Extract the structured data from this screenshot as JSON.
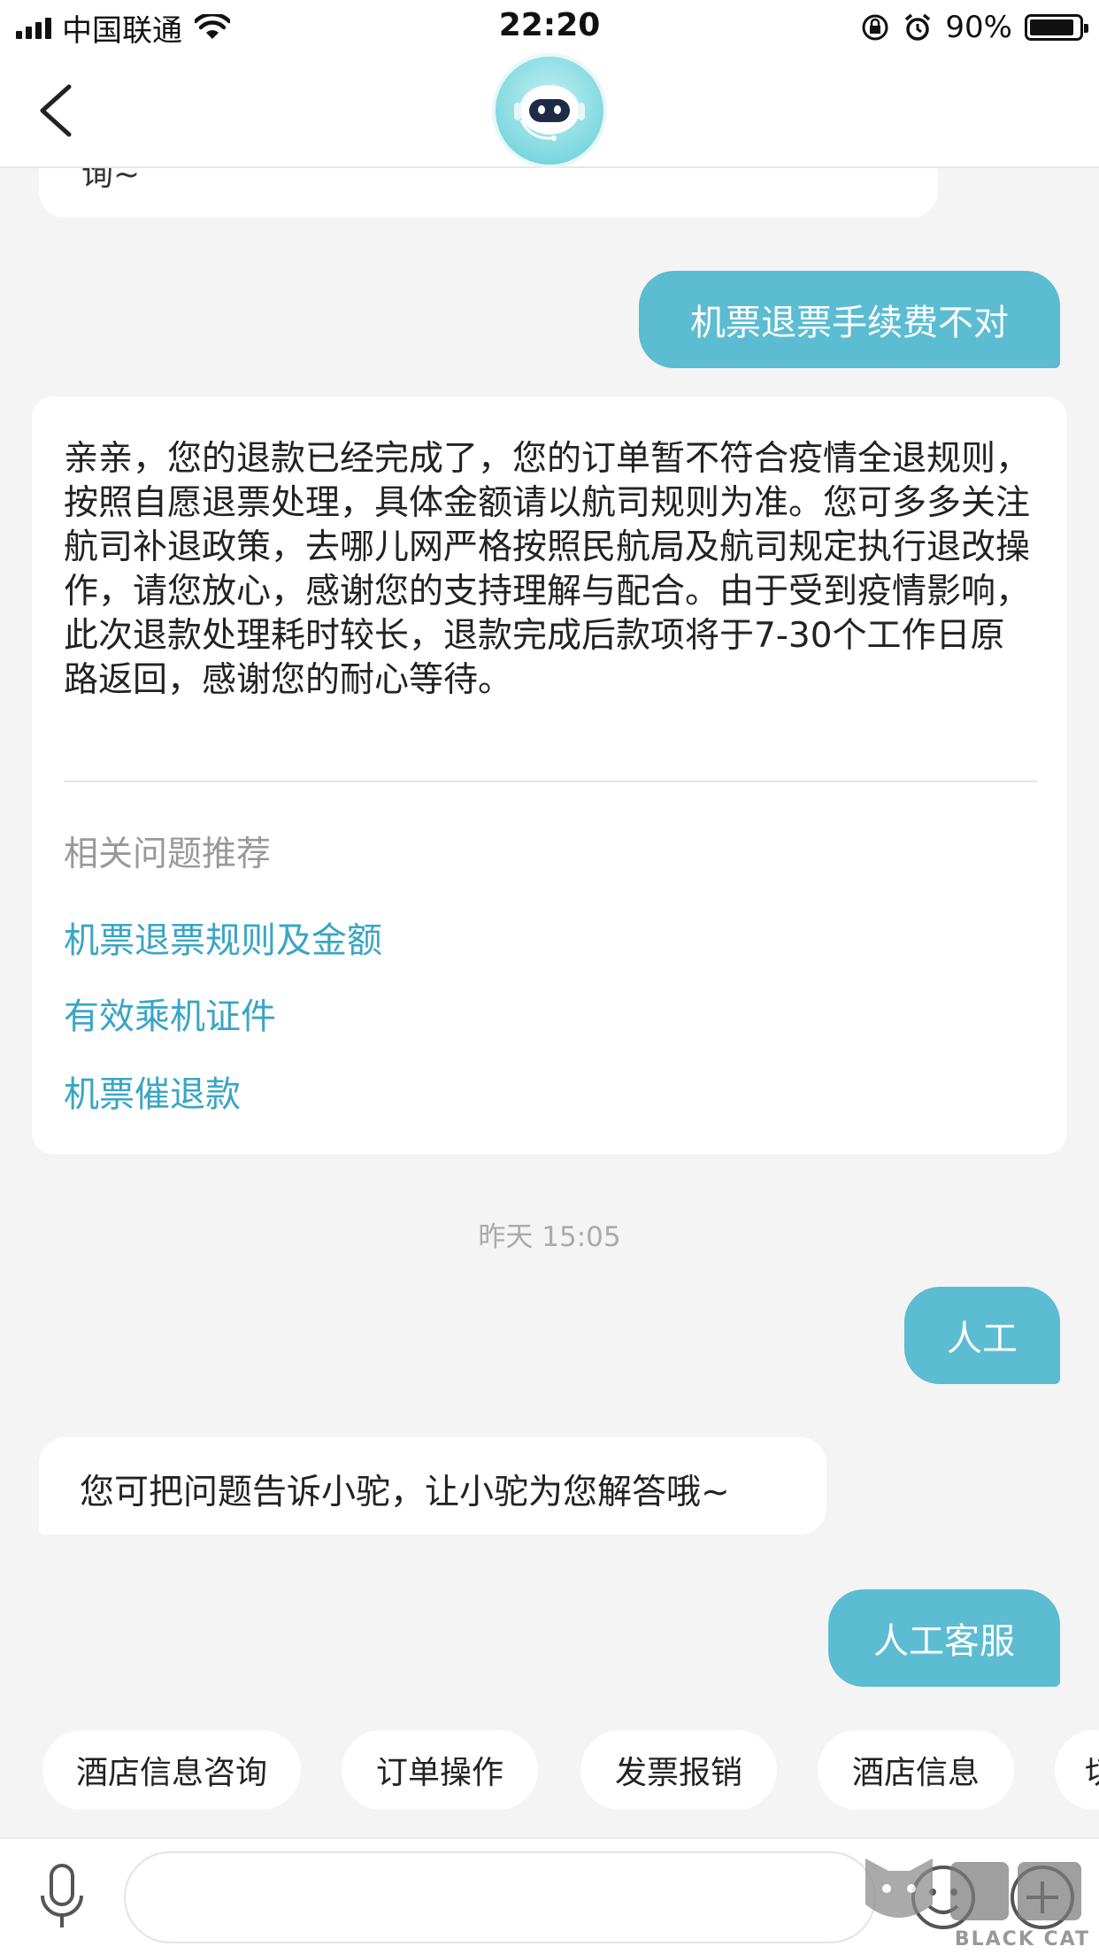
{
  "status_bar": {
    "carrier": "中国联通",
    "time": "22:20",
    "battery_percent": "90%",
    "battery_level": 0.9,
    "icons": [
      "signal-icon",
      "wifi-icon",
      "rotation-lock-icon",
      "alarm-icon",
      "battery-icon"
    ]
  },
  "header": {
    "back_icon": "chevron-left-icon",
    "avatar": "robot-avatar"
  },
  "chat": {
    "prev_fragment": "询~",
    "user_msg_1": "机票退票手续费不对",
    "answer": {
      "text": "亲亲，您的退款已经完成了，您的订单暂不符合疫情全退规则，按照自愿退票处理，具体金额请以航司规则为准。您可多多关注航司补退政策，去哪儿网严格按照民航局及航司规定执行退改操作，请您放心，感谢您的支持理解与配合。由于受到疫情影响，此次退款处理耗时较长，退款完成后款项将于7-30个工作日原路返回，感谢您的耐心等待。",
      "related_title": "相关问题推荐",
      "related_links": [
        "机票退票规则及金额",
        "有效乘机证件",
        "机票催退款"
      ]
    },
    "timestamp": "昨天 15:05",
    "user_msg_2": "人工",
    "bot_reply": "您可把问题告诉小驼，让小驼为您解答哦~",
    "user_msg_3": "人工客服"
  },
  "quick_chips": [
    "酒店信息咨询",
    "订单操作",
    "发票报销",
    "酒店信息",
    "切"
  ],
  "input_bar": {
    "mic_icon": "microphone-icon",
    "placeholder": "",
    "emoji_icon": "emoji-icon",
    "plus_icon": "plus-icon"
  },
  "watermark": {
    "text": "BLACK CAT",
    "logo_text": "黑猫"
  },
  "colors": {
    "accent": "#5bbcd2",
    "link": "#3aa5c4",
    "background": "#f4f4f4"
  }
}
